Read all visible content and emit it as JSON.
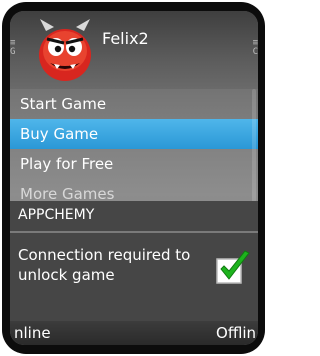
{
  "app": {
    "title": "Felix2",
    "icon": "red-monster-icon"
  },
  "menu": {
    "items": [
      {
        "label": "Start Game",
        "selected": false
      },
      {
        "label": "Buy Game",
        "selected": true
      },
      {
        "label": "Play for Free",
        "selected": false
      },
      {
        "label": "More Games",
        "selected": false
      }
    ]
  },
  "dialog": {
    "title": "APPCHEMY",
    "message": "Connection required to unlock game",
    "check_icon": "green-check-icon"
  },
  "softkeys": {
    "left": "nline",
    "right": "Offlin"
  },
  "colors": {
    "selection": "#2a98d6",
    "dialog_bg": "#464646",
    "check": "#1db31d"
  }
}
